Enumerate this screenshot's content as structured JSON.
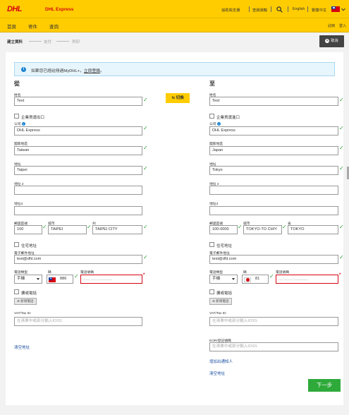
{
  "header": {
    "brand": "DHL Express",
    "links": [
      "協助與支援",
      "查詢運輸"
    ],
    "lang_en": "English",
    "lang_zh": "繁體中文"
  },
  "nav": {
    "items": [
      "首頁",
      "寄件",
      "查詢"
    ],
    "right": [
      "註冊",
      "登入"
    ]
  },
  "steps": [
    "建立資料",
    "支付",
    "列印"
  ],
  "cancel_label": "取消",
  "banner": {
    "text": "如果您已經註冊過MyDHL+，",
    "link": "立即登錄",
    "end": "。"
  },
  "swap_label": "切換",
  "from": {
    "title": "從",
    "name_label": "姓名",
    "name": "Test",
    "business_label": "企業貨運出口",
    "company_label": "公司",
    "company": "DHL Express",
    "country_label": "國家地區",
    "country": "Taiwan",
    "address_label": "地址",
    "address": "Taipei",
    "address2_label": "地址 2",
    "address2": "",
    "address3_label": "地址3",
    "address3": "",
    "postal_label": "郵遞區號",
    "postal": "100",
    "city_label": "城市",
    "city": "TAIPEI",
    "state_label": "州",
    "state": "TAIPEI CITY",
    "residential_label": "住宅地址",
    "email_label": "電子郵件地址",
    "email": "test@dhl.com",
    "phone_type_label": "電話類型",
    "phone_type": "手機",
    "code_label": "碼",
    "code": "886",
    "phone_label": "電話號碼",
    "phone_placeholder": "___ ___ ______",
    "ext_label": "擴或電話",
    "add_phone": "新增電話",
    "vat_label": "VAT/Tax ID",
    "vat_placeholder": "在清單中或部分輸入IOSS",
    "clear_link": "清空地址"
  },
  "to": {
    "title": "至",
    "name_label": "姓名",
    "name": "Test",
    "business_label": "企業貨運進口",
    "company_label": "公司",
    "company": "DHL Express",
    "country_label": "國家地區",
    "country": "Japan",
    "address_label": "地址",
    "address": "Tokyo",
    "address2_label": "地址 2",
    "address2": "",
    "address3_label": "地址3",
    "address3": "",
    "postal_label": "郵遞區號",
    "postal": "100-0000",
    "city_label": "城市",
    "city": "TOKYO-TO CHIY",
    "state_label": "省",
    "state": "TOKYO",
    "residential_label": "住宅地址",
    "email_label": "電子郵件地址",
    "email": "test@dhl.com",
    "phone_type_label": "電話類型",
    "phone_type": "手機",
    "code_label": "碼",
    "code": "81",
    "phone_label": "電話號碼",
    "phone_placeholder": "__-____-______",
    "ext_label": "擴或電話",
    "add_phone": "新增電話",
    "vat_label": "VAT/Tax ID",
    "vat_placeholder": "在清單中或部分輸入IOSS",
    "eori_label": "EORI登記號碼",
    "eori_placeholder": "在清單中或部分輸入IOSS",
    "add_contact": "增加出通知人",
    "clear_link": "清空地址"
  },
  "next_label": "下一步",
  "colors": {
    "yellow": "#ffcc00",
    "red": "#d40511",
    "green": "#2eaa3a"
  }
}
